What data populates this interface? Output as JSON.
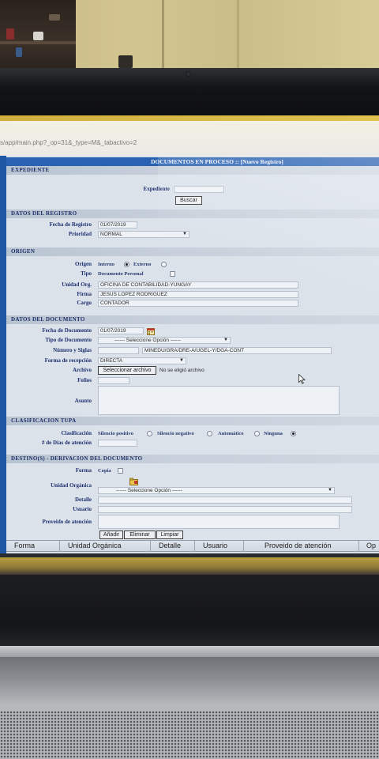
{
  "theme": {
    "frame_blue": "#1e57a4",
    "title_bar": "#2a62b3",
    "section_bar": "#c2ccd8",
    "label_navy": "#1f3170"
  },
  "icons": [
    "calendar-icon",
    "unit-picker-icon",
    "chevron-down-icon",
    "mouse-cursor-icon"
  ],
  "browser": {
    "url": "s/app/main.php?_op=31&_type=M&_tabactivo=2"
  },
  "form": {
    "title": "DOCUMENTOS EN PROCESO :: [Nuevo Registro]",
    "expediente": {
      "section_title": "EXPEDIENTE",
      "label": "Expediente",
      "value": "",
      "search_button": "Buscar"
    },
    "registro": {
      "section_title": "DATOS DEL REGISTRO",
      "fecha": {
        "label": "Fecha de Registro",
        "value": "01/07/2019"
      },
      "prioridad": {
        "label": "Prioridad",
        "selected": "NORMAL"
      }
    },
    "origen": {
      "section_title": "ORIGEN",
      "origen": {
        "label": "Origen",
        "options": [
          {
            "label": "Interno",
            "checked": true
          },
          {
            "label": "Externo",
            "checked": false
          }
        ]
      },
      "tipo": {
        "label": "Tipo",
        "option": "Documento Personal",
        "checked": false
      },
      "unidad": {
        "label": "Unidad Org.",
        "value": "OFICINA DE CONTABILIDAD-YUNGAY"
      },
      "firma": {
        "label": "Firma",
        "value": "JESUS LOPEZ RODRIGUEZ"
      },
      "cargo": {
        "label": "Cargo",
        "value": "CONTADOR"
      }
    },
    "documento": {
      "section_title": "DATOS DEL DOCUMENTO",
      "fecha": {
        "label": "Fecha de Documento",
        "value": "01/07/2019"
      },
      "tipo": {
        "label": "Tipo de Documento",
        "selected": "------ Seleccione Opción ------"
      },
      "numero_siglas": {
        "label": "Número y Siglas",
        "numero": "",
        "siglas": "MINEDU/GRA/DRE-A/UGEL-Y/DGA-CONT"
      },
      "forma_recepcion": {
        "label": "Forma de recepción",
        "selected": "DIRECTA"
      },
      "archivo": {
        "label": "Archivo",
        "button": "Seleccionar archivo",
        "status": "No se eligió archivo"
      },
      "folios": {
        "label": "Folios",
        "value": ""
      },
      "asunto": {
        "label": "Asunto",
        "value": ""
      }
    },
    "tupa": {
      "section_title": "CLASIFICACION TUPA",
      "clasificacion": {
        "label": "Clasificación",
        "options": [
          {
            "label": "Silencio positivo",
            "checked": false
          },
          {
            "label": "Silencio negativo",
            "checked": false
          },
          {
            "label": "Automático",
            "checked": false
          },
          {
            "label": "Ninguna",
            "checked": true
          }
        ]
      },
      "dias": {
        "label": "# de Días de atención",
        "value": ""
      }
    },
    "destino": {
      "section_title": "DESTINO(S) - DERIVACION DEL DOCUMENTO",
      "forma": {
        "label": "Forma",
        "option": "Copia",
        "checked": false
      },
      "unidad": {
        "label": "Unidad Orgánica",
        "selected": "------ Seleccione Opción ------"
      },
      "detalle": {
        "label": "Detalle",
        "value": ""
      },
      "usuario": {
        "label": "Usuario",
        "value": ""
      },
      "proveido": {
        "label": "Proveido de atención",
        "value": ""
      },
      "buttons": {
        "add": "Añadir",
        "remove": "Eliminar",
        "clear": "Limpiar"
      },
      "table": {
        "columns": [
          "Forma",
          "Unidad Orgánica",
          "Detalle",
          "Usuario",
          "Proveido de atención",
          "Op"
        ]
      }
    }
  }
}
